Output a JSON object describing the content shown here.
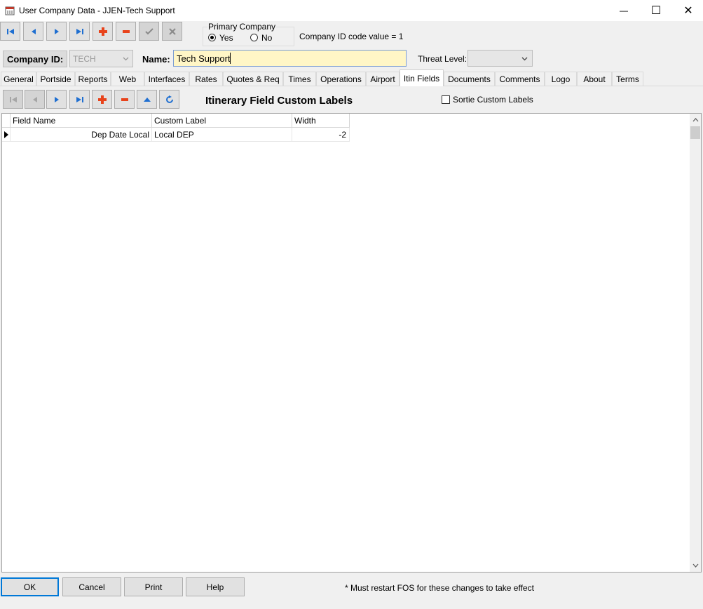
{
  "window": {
    "title": "User Company Data - JJEN-Tech Support",
    "minimize_glyph": "—",
    "maximize_glyph": "☐",
    "close_glyph": "✕"
  },
  "toolbar": {
    "buttons": [
      "first-record-icon",
      "prior-record-icon",
      "next-record-icon",
      "last-record-icon",
      "add-record-icon",
      "delete-record-icon",
      "post-icon",
      "cancel-edit-icon"
    ]
  },
  "primary_company": {
    "label": "Primary Company",
    "yes_label": "Yes",
    "no_label": "No",
    "selected": "Yes"
  },
  "company_id_note": "Company ID code value = 1",
  "company_id": {
    "label": "Company ID:",
    "value": "TECH"
  },
  "name": {
    "label": "Name:",
    "value": "Tech Support"
  },
  "threat_level": {
    "label": "Threat Level:",
    "value": ""
  },
  "tabs": [
    "General",
    "Portside",
    "Reports",
    "Web",
    "Interfaces",
    "Rates",
    "Quotes & Req",
    "Times",
    "Operations",
    "Airport",
    "Itin Fields",
    "Documents",
    "Comments",
    "Logo",
    "About",
    "Terms"
  ],
  "active_tab": "Itin Fields",
  "panel": {
    "title": "Itinerary Field Custom Labels",
    "sortie_label": "Sortie Custom Labels",
    "sortie_checked": false
  },
  "grid": {
    "columns": [
      "Field Name",
      "Custom Label",
      "Width"
    ],
    "rows": [
      {
        "field_name": "Dep Date Local",
        "custom_label": "Local DEP",
        "width": "-2"
      }
    ]
  },
  "footer": {
    "ok": "OK",
    "cancel": "Cancel",
    "print": "Print",
    "help": "Help",
    "note": "* Must restart FOS for these changes to take effect"
  },
  "colors": {
    "nav_blue": "#1f6fd1",
    "add_red": "#e8431b",
    "name_field_bg": "#fff6c6"
  }
}
